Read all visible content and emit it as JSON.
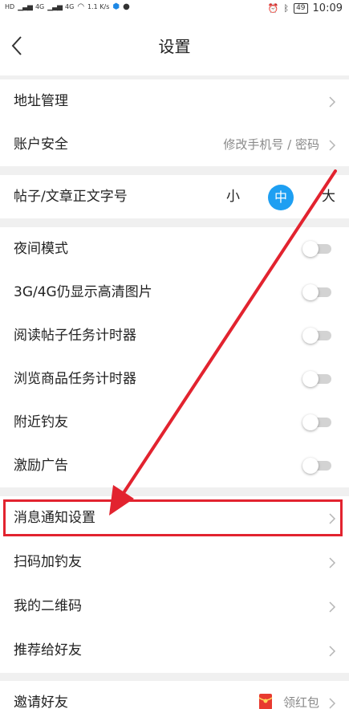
{
  "status_bar": {
    "left_indicators": [
      "HD",
      "4G",
      "4G",
      "1.1 K/s"
    ],
    "battery": "49",
    "time": "10:09"
  },
  "header": {
    "title": "设置"
  },
  "rows": {
    "address": {
      "label": "地址管理"
    },
    "account": {
      "label": "账户安全",
      "value": "修改手机号 / 密码"
    },
    "font_size": {
      "label": "帖子/文章正文字号",
      "small": "小",
      "medium": "中",
      "large": "大"
    },
    "night_mode": {
      "label": "夜间模式"
    },
    "hd_images": {
      "label": "3G/4G仍显示高清图片"
    },
    "read_timer": {
      "label": "阅读帖子任务计时器"
    },
    "browse_timer": {
      "label": "浏览商品任务计时器"
    },
    "nearby": {
      "label": "附近钓友"
    },
    "ads": {
      "label": "激励广告"
    },
    "notify": {
      "label": "消息通知设置"
    },
    "scan_add": {
      "label": "扫码加钓友"
    },
    "my_qr": {
      "label": "我的二维码"
    },
    "recommend": {
      "label": "推荐给好友"
    },
    "invite": {
      "label": "邀请好友",
      "value": "领红包"
    }
  },
  "colors": {
    "accent": "#1e9ff2",
    "highlight": "#e2232f",
    "toggle_off": "#d3d3d3"
  }
}
